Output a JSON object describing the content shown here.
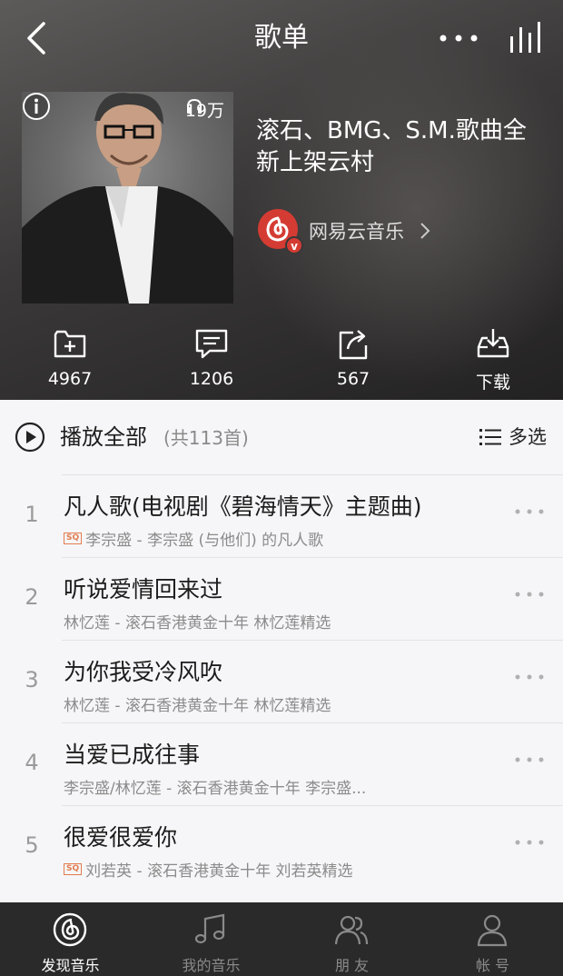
{
  "header": {
    "title": "歌单"
  },
  "playlist": {
    "title": "滚石、BMG、S.M.歌曲全新上架云村",
    "play_count": "19万",
    "creator": "网易云音乐"
  },
  "actions": [
    {
      "name": "collect",
      "label": "4967"
    },
    {
      "name": "comment",
      "label": "1206"
    },
    {
      "name": "share",
      "label": "567"
    },
    {
      "name": "download",
      "label": "下载"
    }
  ],
  "list": {
    "play_all_label": "播放全部",
    "count_label": "(共113首)",
    "multi_select_label": "多选",
    "songs": [
      {
        "index": "1",
        "title": "凡人歌(电视剧《碧海情天》主题曲)",
        "subtitle": "李宗盛 - 李宗盛 (与他们) 的凡人歌",
        "sq": true
      },
      {
        "index": "2",
        "title": "听说爱情回来过",
        "subtitle": "林忆莲 - 滚石香港黄金十年 林忆莲精选",
        "sq": false
      },
      {
        "index": "3",
        "title": "为你我受冷风吹",
        "subtitle": "林忆莲 - 滚石香港黄金十年 林忆莲精选",
        "sq": false
      },
      {
        "index": "4",
        "title": "当爱已成往事",
        "subtitle": "李宗盛/林忆莲 - 滚石香港黄金十年 李宗盛...",
        "sq": false
      },
      {
        "index": "5",
        "title": "很爱很爱你",
        "subtitle": "刘若英 - 滚石香港黄金十年 刘若英精选",
        "sq": true
      }
    ],
    "sq_badge": "SQ"
  },
  "tabs": [
    {
      "label": "发现音乐",
      "icon": "netease-logo-icon",
      "active": true
    },
    {
      "label": "我的音乐",
      "icon": "music-note-icon",
      "active": false
    },
    {
      "label": "朋 友",
      "icon": "friends-icon",
      "active": false
    },
    {
      "label": "帐 号",
      "icon": "account-icon",
      "active": false
    }
  ],
  "colors": {
    "accent": "#d43c33",
    "tabbar": "#2b2a2a",
    "list_bg": "#f6f6f8"
  }
}
